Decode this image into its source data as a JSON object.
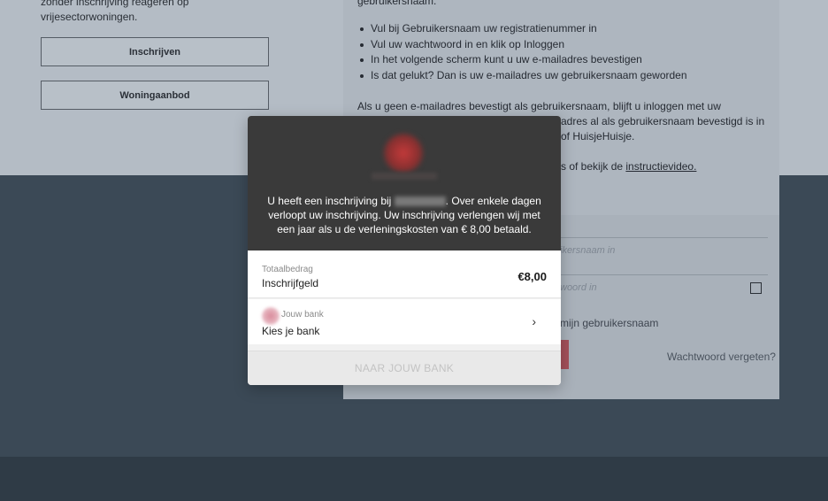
{
  "left": {
    "intro_line1": "zonder inschrijving reageren op",
    "intro_line2": "vrijesectorwoningen.",
    "btn_inschrijven": "Inschrijven",
    "btn_woningaanbod": "Woningaanbod"
  },
  "right": {
    "top_text": "gebruikersnaam.",
    "bullets": [
      "Vul bij Gebruikersnaam uw registratienummer in",
      "Vul uw wachtwoord in en klik op Inloggen",
      "In het volgende scherm kunt u uw e-mailadres bevestigen",
      "Is dat gelukt? Dan is uw e-mailadres uw gebruikersnaam geworden"
    ],
    "para_line1": "Als u geen e-mailadres bevestigt als gebruikersnaam, blijft u inloggen met uw",
    "para_line2_frag": "adres al als gebruikersnaam bevestigd is in",
    "para_line3_frag": "of HuisjeHuisje.",
    "para_line4_frag": "s of bekijk de",
    "video_link": "instructievideo.",
    "username_placeholder_frag": "ikersnaam in",
    "password_placeholder_frag": "woord in",
    "remember_frag": "mijn gebruikersnaam",
    "forgot_link": "Wachtwoord vergeten?"
  },
  "modal": {
    "message_pre": "U heeft een inschrijving bij",
    "message_post": ". Over enkele dagen verloopt uw inschrijving. Uw inschrijving verlengen wij met een jaar als u de verleningskosten van € 8,00 betaald.",
    "total_label": "Totaalbedrag",
    "item_label": "Inschrijfgeld",
    "amount": "€8,00",
    "bank_small_label": "Jouw bank",
    "bank_choose": "Kies je bank",
    "chevron": "›",
    "pay_button": "NAAR JOUW BANK"
  },
  "colors": {
    "modal_header": "#3a3a3a",
    "pay_button_text": "#c3c3c3",
    "login_button": "#a4505a"
  }
}
